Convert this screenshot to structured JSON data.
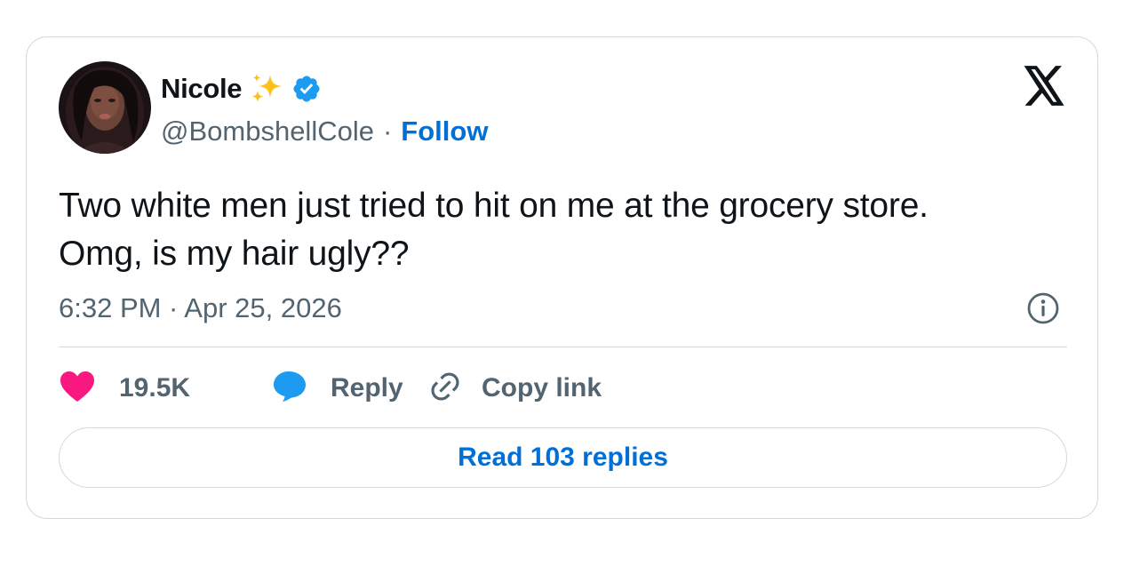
{
  "author": {
    "display_name": "Nicole",
    "handle": "@BombshellCole",
    "separator": "·",
    "follow_label": "Follow",
    "badge_icon": "sparkles-icon",
    "verified_icon": "verified-badge-icon"
  },
  "tweet": {
    "text": "Two white men just tried to hit on me at the grocery store.\nOmg, is my hair ugly??",
    "timestamp": "6:32 PM · Apr 25, 2026"
  },
  "actions": {
    "likes_count": "19.5K",
    "reply_label": "Reply",
    "copy_link_label": "Copy link"
  },
  "footer": {
    "read_replies_label": "Read 103 replies"
  },
  "colors": {
    "accent": "#006fd6",
    "like": "#f91880",
    "reply_bubble": "#1d9bf0",
    "secondary_text": "#536471",
    "border": "#cfd9de"
  }
}
